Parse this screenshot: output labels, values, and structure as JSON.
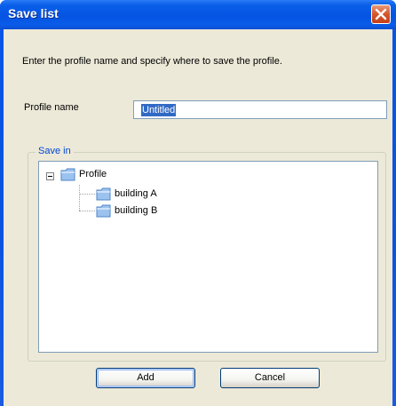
{
  "window": {
    "title": "Save list",
    "close_icon": "close-x-icon",
    "colors": {
      "titlebar": "#0554e3",
      "client": "#ece9d8",
      "close": "#d5552a",
      "selection": "#316ac5",
      "group_label": "#0046d5"
    }
  },
  "dialog": {
    "instructions": "Enter the profile name and specify where to save the profile.",
    "profile_name_label": "Profile name",
    "profile_name_value": "Untitled",
    "save_in_label": "Save in",
    "tree": {
      "root": {
        "label": "Profile",
        "icon": "folder-icon",
        "expanded": true
      },
      "children": [
        {
          "label": "building A",
          "icon": "folder-icon"
        },
        {
          "label": "building B",
          "icon": "folder-icon"
        }
      ]
    },
    "buttons": {
      "add": "Add",
      "cancel": "Cancel"
    }
  }
}
